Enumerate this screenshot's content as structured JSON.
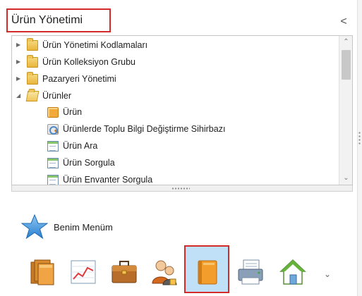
{
  "header": {
    "title": "Ürün Yönetimi",
    "collapse_symbol": "<"
  },
  "tree": {
    "items": [
      {
        "label": "Ürün Yönetimi Kodlamaları",
        "icon": "folder-icon",
        "expander": "collapsed"
      },
      {
        "label": "Ürün Kolleksiyon Grubu",
        "icon": "folder-icon",
        "expander": "collapsed"
      },
      {
        "label": "Pazaryeri Yönetimi",
        "icon": "folder-icon",
        "expander": "collapsed"
      },
      {
        "label": "Ürünler",
        "icon": "folder-open-icon",
        "expander": "expanded"
      },
      {
        "label": "Ürün",
        "icon": "product-icon"
      },
      {
        "label": "Ürünlerde Toplu Bilgi Değiştirme Sihirbazı",
        "icon": "wizard-icon"
      },
      {
        "label": "Ürün Ara",
        "icon": "form-icon"
      },
      {
        "label": "Ürün Sorgula",
        "icon": "form-icon"
      },
      {
        "label": "Ürün Envanter Sorgula",
        "icon": "form-icon"
      }
    ],
    "scroll_up_symbol": "⌃",
    "scroll_down_symbol": "⌄"
  },
  "favorites": {
    "label": "Benim Menüm",
    "icon": "star-icon"
  },
  "icon_bar": {
    "icons": [
      {
        "name": "stacked-books-icon"
      },
      {
        "name": "line-chart-icon"
      },
      {
        "name": "briefcase-icon"
      },
      {
        "name": "users-icon"
      },
      {
        "name": "orange-book-icon",
        "selected": true
      },
      {
        "name": "printer-icon"
      },
      {
        "name": "home-icon"
      }
    ],
    "more_symbol": "⌄"
  },
  "colors": {
    "highlight_border": "#d42a2a",
    "selected_background": "#bfe0f7",
    "folder_yellow": "#e9b53b"
  }
}
